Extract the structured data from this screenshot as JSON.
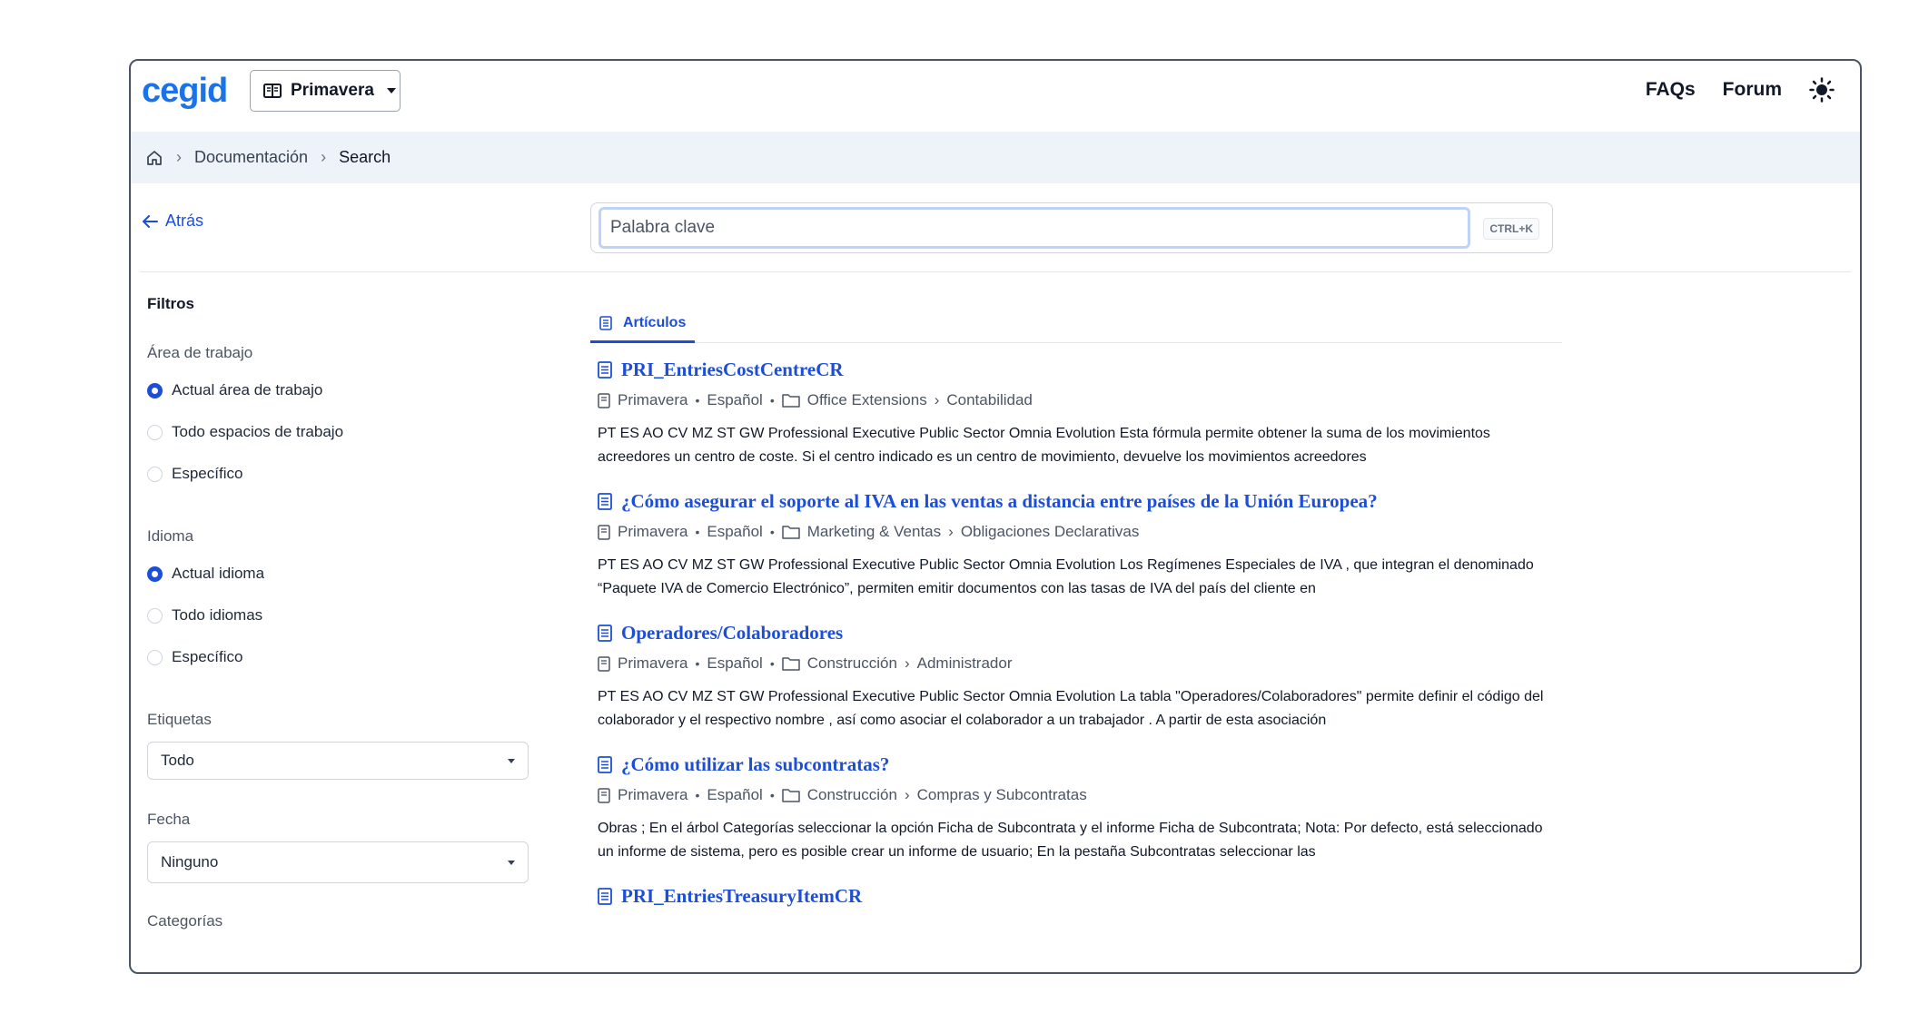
{
  "header": {
    "logo": "cegid",
    "product": "Primavera",
    "nav": {
      "faqs": "FAQs",
      "forum": "Forum"
    }
  },
  "breadcrumb": {
    "level1": "Documentación",
    "current": "Search"
  },
  "back_label": "Atrás",
  "search": {
    "placeholder": "Palabra clave",
    "shortcut": "CTRL+K"
  },
  "filters": {
    "title": "Filtros",
    "workspace": {
      "label": "Área de trabajo",
      "options": [
        "Actual área de trabajo",
        "Todo espacios de trabajo",
        "Específico"
      ],
      "selected": 0
    },
    "language": {
      "label": "Idioma",
      "options": [
        "Actual idioma",
        "Todo idiomas",
        "Específico"
      ],
      "selected": 0
    },
    "tags": {
      "label": "Etiquetas",
      "value": "Todo"
    },
    "date": {
      "label": "Fecha",
      "value": "Ninguno"
    },
    "categories": {
      "label": "Categorías"
    }
  },
  "tabs": {
    "articles": "Artículos"
  },
  "results": [
    {
      "title": "PRI_EntriesCostCentreCR",
      "product": "Primavera",
      "language": "Español",
      "folder": "Office Extensions",
      "category": "Contabilidad",
      "snippet": "PT ES AO CV MZ ST GW Professional Executive Public Sector Omnia Evolution Esta fórmula permite obtener la suma de los movimientos acreedores un centro de coste. Si el centro indicado es un centro de movimiento, devuelve los movimientos acreedores"
    },
    {
      "title": "¿Cómo asegurar el soporte al IVA en las ventas a distancia entre países de la Unión Europea?",
      "product": "Primavera",
      "language": "Español",
      "folder": "Marketing & Ventas",
      "category": "Obligaciones Declarativas",
      "snippet": "PT ES AO CV MZ ST GW Professional Executive Public Sector Omnia Evolution Los Regímenes Especiales de IVA , que integran el denominado “Paquete IVA de Comercio Electrónico”, permiten emitir documentos con las tasas de IVA del país del cliente en"
    },
    {
      "title": "Operadores/Colaboradores",
      "product": "Primavera",
      "language": "Español",
      "folder": "Construcción",
      "category": "Administrador",
      "snippet": "PT ES AO CV MZ ST GW Professional Executive Public Sector Omnia Evolution La tabla \"Operadores/Colaboradores\" permite definir el código del colaborador y el respectivo nombre , así como asociar el colaborador a un trabajador . A partir de esta asociación"
    },
    {
      "title": "¿Cómo utilizar las subcontratas?",
      "product": "Primavera",
      "language": "Español",
      "folder": "Construcción",
      "category": "Compras y Subcontratas",
      "snippet": "Obras ; En el árbol Categorías seleccionar la opción Ficha de Subcontrata y el informe Ficha de Subcontrata; Nota: Por defecto, está seleccionado un informe de sistema, pero es posible crear un informe de usuario; En la pestaña Subcontratas seleccionar las"
    },
    {
      "title": "PRI_EntriesTreasuryItemCR",
      "product": "",
      "language": "",
      "folder": "",
      "category": "",
      "snippet": ""
    }
  ],
  "colors": {
    "accent": "#1d4ed8",
    "breadcrumb_bg": "#eef3fa",
    "logo": "#1a73e8"
  }
}
